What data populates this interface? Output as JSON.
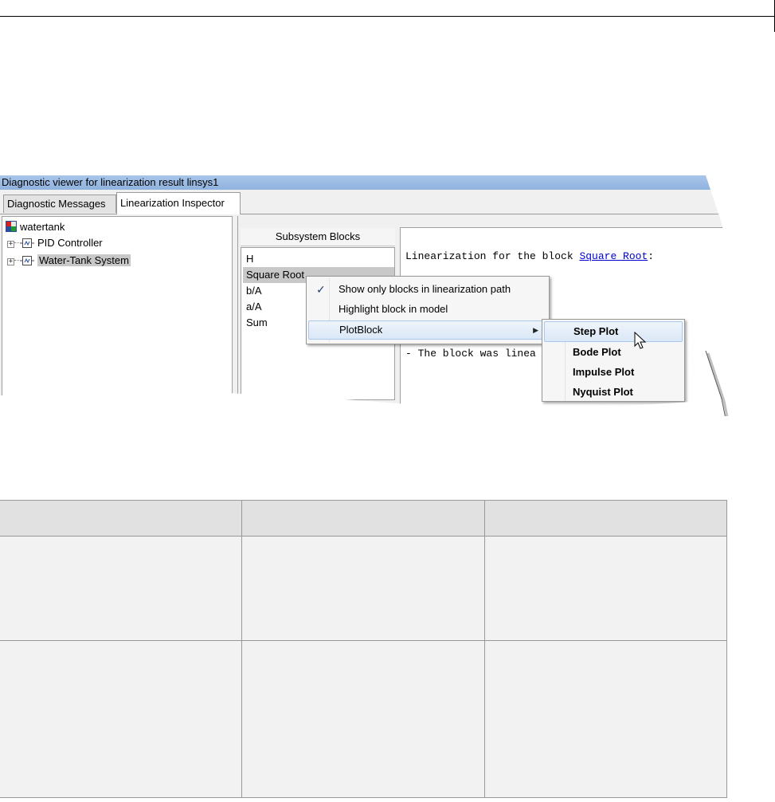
{
  "window": {
    "title": "Diagnostic viewer for linearization result linsys1"
  },
  "tabs": [
    {
      "label": "Diagnostic Messages",
      "active": false
    },
    {
      "label": "Linearization Inspector",
      "active": true
    }
  ],
  "tree": {
    "root": "watertank",
    "items": [
      {
        "label": "PID Controller",
        "selected": false
      },
      {
        "label": "Water-Tank System",
        "selected": true
      }
    ]
  },
  "blocks": {
    "header": "Subsystem Blocks",
    "items": [
      "H",
      "Square Root",
      "b/A",
      "a/A",
      "Sum"
    ],
    "selected": "Square Root"
  },
  "info": {
    "line1_prefix": "Linearization for the block ",
    "line1_link": "Square Root",
    "line1_suffix": ":",
    "line2": "- The block was linea"
  },
  "context_menu": {
    "items": [
      {
        "label": "Show only blocks in linearization path",
        "checked": true
      },
      {
        "label": "Highlight block in model"
      },
      {
        "label": "PlotBlock",
        "submenu": true
      }
    ],
    "submenu": [
      "Step Plot",
      "Bode Plot",
      "Impulse Plot",
      "Nyquist Plot"
    ],
    "submenu_highlighted": "Step Plot"
  },
  "icons": {
    "model": "simulink-model-icon",
    "subsystem": "subsystem-block-icon",
    "check": "checkmark-icon",
    "submenu_arrow": "triangle-right-icon",
    "cursor": "mouse-pointer-icon"
  },
  "colors": {
    "titlebar": "#a9c6ea",
    "selection": "#c8c8c8",
    "menu_highlight": "#dbe8f7",
    "link": "#0000d0",
    "table_header": "#e1e1e1",
    "table_body": "#f2f2f2"
  }
}
